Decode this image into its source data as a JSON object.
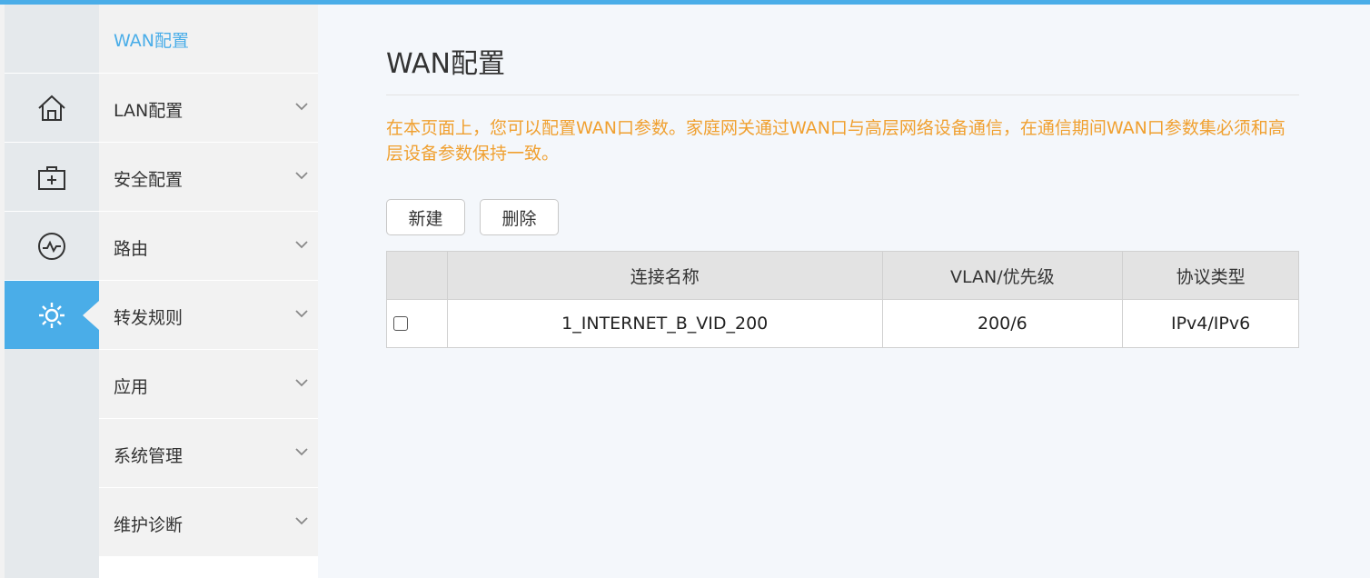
{
  "colors": {
    "accent": "#4aade8",
    "notice": "#f0a030"
  },
  "iconbar": {
    "items": [
      {
        "icon": "home-icon"
      },
      {
        "icon": "toolbox-icon"
      },
      {
        "icon": "monitor-pulse-icon"
      },
      {
        "icon": "gear-icon",
        "active": true
      }
    ]
  },
  "menu": {
    "title": "WAN配置",
    "items": [
      {
        "label": "LAN配置"
      },
      {
        "label": "安全配置"
      },
      {
        "label": "路由"
      },
      {
        "label": "转发规则"
      },
      {
        "label": "应用"
      },
      {
        "label": "系统管理"
      },
      {
        "label": "维护诊断"
      }
    ]
  },
  "main": {
    "title": "WAN配置",
    "description": "在本页面上，您可以配置WAN口参数。家庭网关通过WAN口与高层网络设备通信，在通信期间WAN口参数集必须和高层设备参数保持一致。",
    "buttons": {
      "new": "新建",
      "delete": "删除"
    },
    "table": {
      "headers": [
        "",
        "连接名称",
        "VLAN/优先级",
        "协议类型"
      ],
      "rows": [
        {
          "name": "1_INTERNET_B_VID_200",
          "vlan": "200/6",
          "protocol": "IPv4/IPv6"
        }
      ]
    }
  }
}
